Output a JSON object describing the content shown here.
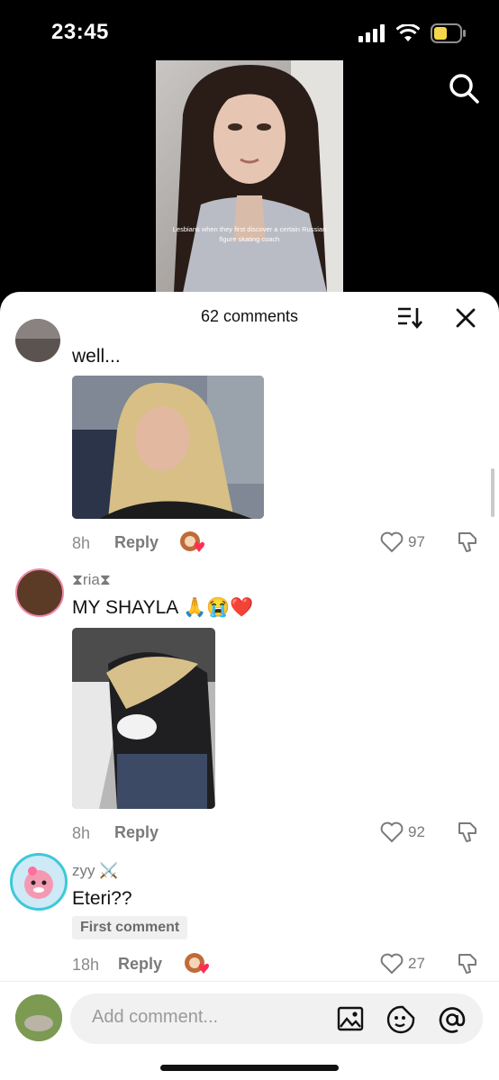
{
  "status_bar": {
    "time": "23:45"
  },
  "video": {
    "caption": "Lesbians when they first discover a certain Russian figure skating coach"
  },
  "sheet": {
    "title": "62 comments",
    "comments": [
      {
        "username": "",
        "text": "well...",
        "time": "8h",
        "reply_label": "Reply",
        "likes": "97"
      },
      {
        "username": "⧗ria⧗",
        "text": "MY SHAYLA 🙏😭❤️",
        "time": "8h",
        "reply_label": "Reply",
        "likes": "92"
      },
      {
        "username": "zyy ⚔️",
        "text": "Eteri??",
        "badge": "First comment",
        "time": "18h",
        "reply_label": "Reply",
        "likes": "27"
      }
    ],
    "input_placeholder": "Add comment..."
  },
  "colors": {
    "heart_badge": "#ff2d55",
    "like_grey": "#7a7a7a",
    "sheet_bg": "#ffffff"
  },
  "icons": [
    "search-icon",
    "sort-icon",
    "close-icon",
    "heart-icon",
    "dislike-icon",
    "image-icon",
    "sticker-icon",
    "mention-icon"
  ]
}
